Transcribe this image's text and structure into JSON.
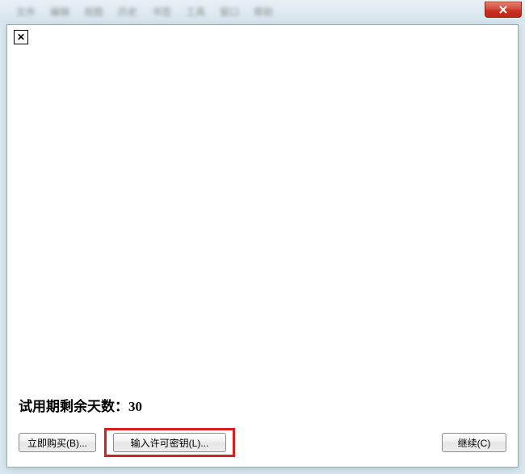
{
  "chrome": {
    "menu_items": [
      "文件",
      "编辑",
      "视图",
      "历史",
      "书签",
      "工具",
      "窗口",
      "帮助"
    ]
  },
  "dialog": {
    "trial_label_prefix": "试用期剩余天数：",
    "trial_days": "30",
    "buttons": {
      "buy_now": "立即购买(B)...",
      "enter_license": "输入许可密钥(L)...",
      "continue": "继续(C)"
    }
  }
}
